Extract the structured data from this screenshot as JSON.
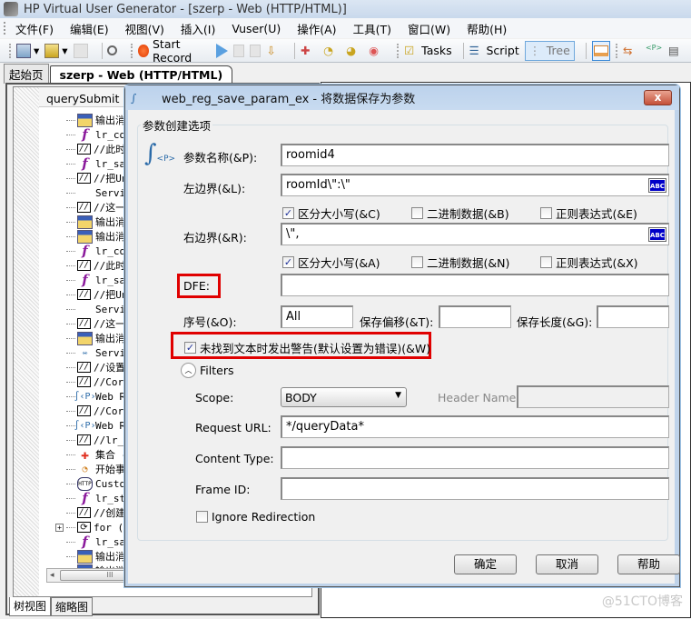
{
  "window": {
    "title": "HP Virtual User Generator - [szerp - Web (HTTP/HTML)]"
  },
  "menu": [
    "文件(F)",
    "编辑(E)",
    "视图(V)",
    "插入(I)",
    "Vuser(U)",
    "操作(A)",
    "工具(T)",
    "窗口(W)",
    "帮助(H)"
  ],
  "toolbar": {
    "start_record": "Start Record",
    "tasks": "Tasks",
    "script": "Script",
    "tree": "Tree"
  },
  "doc_tabs": [
    "起始页",
    "szerp - Web (HTTP/HTML)"
  ],
  "left_panel": {
    "header": "querySubmit",
    "tree": [
      {
        "icon": "message-icon",
        "text": "输出消息"
      },
      {
        "icon": "function-icon",
        "text": "lr_conve"
      },
      {
        "icon": "comment-icon",
        "text": "//此时g"
      },
      {
        "icon": "function-icon",
        "text": "lr_save_"
      },
      {
        "icon": "comment-icon",
        "text": "//把Uni"
      },
      {
        "icon": "none",
        "text": "Service"
      },
      {
        "icon": "comment-icon",
        "text": "//这一步"
      },
      {
        "icon": "message-icon",
        "text": "输出消息"
      },
      {
        "icon": "message-icon",
        "text": "输出消息"
      },
      {
        "icon": "function-icon",
        "text": "lr_conve"
      },
      {
        "icon": "comment-icon",
        "text": "//此时r"
      },
      {
        "icon": "function-icon",
        "text": "lr_save_"
      },
      {
        "icon": "comment-icon",
        "text": "//把Uni"
      },
      {
        "icon": "none",
        "text": "Service"
      },
      {
        "icon": "comment-icon",
        "text": "//这一步"
      },
      {
        "icon": "message-icon",
        "text": "输出消息"
      },
      {
        "icon": "service-icon",
        "text": "Service"
      },
      {
        "icon": "comment-icon",
        "text": "//设置关"
      },
      {
        "icon": "comment-icon",
        "text": "//Corre"
      },
      {
        "icon": "web-reg-icon",
        "text": "Web Reg"
      },
      {
        "icon": "comment-icon",
        "text": "//Corre"
      },
      {
        "icon": "web-reg-icon",
        "text": "Web Reg"
      },
      {
        "icon": "comment-icon",
        "text": "//lr_th"
      },
      {
        "icon": "rendezvous-icon",
        "text": "集合 - "
      },
      {
        "icon": "transaction-icon",
        "text": "开始事务"
      },
      {
        "icon": "http-icon",
        "text": "Custom R"
      },
      {
        "icon": "function-icon",
        "text": "lr_start"
      },
      {
        "icon": "comment-icon",
        "text": "//创建计"
      },
      {
        "icon": "loop-icon",
        "text": "for (num"
      },
      {
        "icon": "function-icon",
        "text": "lr_save_"
      },
      {
        "icon": "message-icon",
        "text": "输出消息"
      },
      {
        "icon": "message-icon",
        "text": "输出消息"
      }
    ],
    "bottom_tabs": [
      "树视图",
      "缩略图"
    ]
  },
  "dialog": {
    "title": "web_reg_save_param_ex - 将数据保存为参数",
    "close": "x",
    "group_label": "参数创建选项",
    "param_name_label": "参数名称(&P):",
    "param_name_value": "roomid4",
    "left_boundary_label": "左边界(&L):",
    "left_boundary_value": "roomId\\\":\\\"",
    "left_options": [
      {
        "label": "区分大小写(&C)",
        "checked": true
      },
      {
        "label": "二进制数据(&B)",
        "checked": false
      },
      {
        "label": "正则表达式(&E)",
        "checked": false
      }
    ],
    "right_boundary_label": "右边界(&R):",
    "right_boundary_value": "\\\",",
    "right_options": [
      {
        "label": "区分大小写(&A)",
        "checked": true
      },
      {
        "label": "二进制数据(&N)",
        "checked": false
      },
      {
        "label": "正则表达式(&X)",
        "checked": false
      }
    ],
    "abc_button": "ABC",
    "dfe_label": "DFE:",
    "dfe_value": "",
    "ordinal_label": "序号(&O):",
    "ordinal_value": "All",
    "save_offset_label": "保存偏移(&T):",
    "save_offset_value": "",
    "save_length_label": "保存长度(&G):",
    "save_length_value": "",
    "warn_label": "未找到文本时发出警告(默认设置为错误)(&W)",
    "warn_checked": true,
    "filters_label": "Filters",
    "scope_label": "Scope:",
    "scope_value": "BODY",
    "header_name_label": "Header Name:",
    "header_name_value": "",
    "request_url_label": "Request URL:",
    "request_url_value": "*/queryData*",
    "content_type_label": "Content Type:",
    "content_type_value": "",
    "frame_id_label": "Frame ID:",
    "frame_id_value": "",
    "ignore_redirection_label": "Ignore Redirection",
    "ignore_redirection_checked": false,
    "buttons": {
      "ok": "确定",
      "cancel": "取消",
      "help": "帮助"
    }
  },
  "watermark": "@51CTO博客",
  "colors": {
    "highlight_red": "#e00000",
    "abc_blue": "#0000c8",
    "title_blue": "#c8dbf0"
  }
}
